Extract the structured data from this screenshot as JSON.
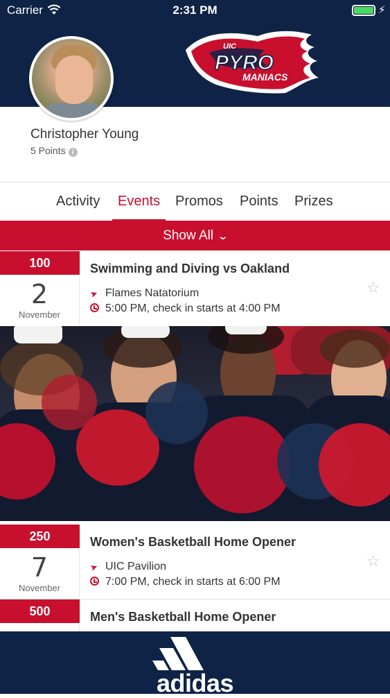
{
  "status_bar": {
    "carrier": "Carrier",
    "time": "2:31 PM",
    "battery_level": 1.0
  },
  "branding": {
    "logo_small_text": "UIC",
    "logo_main_text": "PYRO",
    "logo_sub_text": "MANIACS",
    "footer_brand": "adidas"
  },
  "profile": {
    "name": "Christopher Young",
    "points": "5 Points"
  },
  "tabs": [
    {
      "label": "Activity",
      "active": false
    },
    {
      "label": "Events",
      "active": true
    },
    {
      "label": "Promos",
      "active": false
    },
    {
      "label": "Points",
      "active": false
    },
    {
      "label": "Prizes",
      "active": false
    }
  ],
  "filter": {
    "label": "Show All"
  },
  "events": [
    {
      "points": "100",
      "day": "2",
      "month": "November",
      "title": "Swimming and Diving vs Oakland",
      "location": "Flames Natatorium",
      "time": "5:00 PM, check in starts at 4:00 PM"
    },
    {
      "points": "250",
      "day": "7",
      "month": "November",
      "title": "Women's Basketball Home Opener",
      "location": "UIC Pavilion",
      "time": "7:00 PM, check in starts at 6:00 PM"
    },
    {
      "points": "500",
      "title": "Men's Basketball Home Opener"
    }
  ],
  "colors": {
    "navy": "#0f2347",
    "accent_red": "#c8102e",
    "battery_green": "#4cd964"
  },
  "icons": [
    "wifi-icon",
    "battery-icon",
    "info-icon",
    "chevron-down-icon",
    "location-arrow-icon",
    "clock-icon",
    "star-icon",
    "adidas-logo-icon"
  ]
}
